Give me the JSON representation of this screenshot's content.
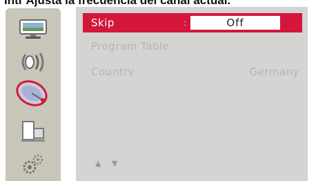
{
  "header": {
    "caption": "Intr Ajusta la frecuencia del canal actual."
  },
  "sidebar": {
    "icons": [
      {
        "name": "picture-icon"
      },
      {
        "name": "audio-icon"
      },
      {
        "name": "channel-satellite-icon",
        "selected": true
      },
      {
        "name": "input-icon"
      },
      {
        "name": "settings-icon"
      }
    ]
  },
  "menu": {
    "rows": [
      {
        "label": "Skip",
        "separator": ":",
        "value": "Off",
        "selected": true
      },
      {
        "label": "Program Table"
      },
      {
        "label": "Country",
        "value": "Germany"
      }
    ],
    "nav_hint": "▲ ▼"
  },
  "colors": {
    "accent": "#d4163a",
    "panel": "#d6d4d2",
    "sidebar": "#c8c6b8"
  }
}
